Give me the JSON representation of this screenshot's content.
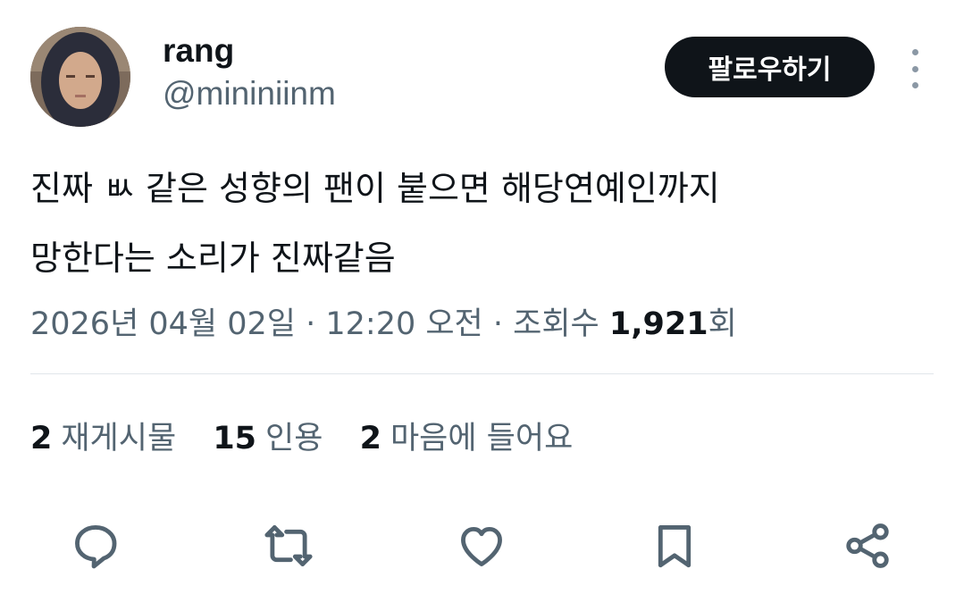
{
  "user": {
    "name": "rang",
    "handle": "@mininiinm",
    "follow_label": "팔로우하기"
  },
  "tweet": {
    "line1": "진짜 ㅄ 같은 성향의 팬이 붙으면 해당연예인까지",
    "line2": "망한다는 소리가 진짜같음"
  },
  "meta": {
    "datetime": "2026년 04월 02일 · 12:20 오전 · 조회수 ",
    "views": "1,921",
    "views_suffix": "회"
  },
  "stats": [
    {
      "count": "2",
      "label": "재게시물"
    },
    {
      "count": "15",
      "label": "인용"
    },
    {
      "count": "2",
      "label": "마음에 들어요"
    }
  ],
  "actions": [
    "reply-icon",
    "repost-icon",
    "like-icon",
    "bookmark-icon",
    "share-icon"
  ],
  "colors": {
    "text": "#0f1419",
    "secondary": "#536471",
    "follow_bg": "#0f1419",
    "icon": "#536471"
  }
}
